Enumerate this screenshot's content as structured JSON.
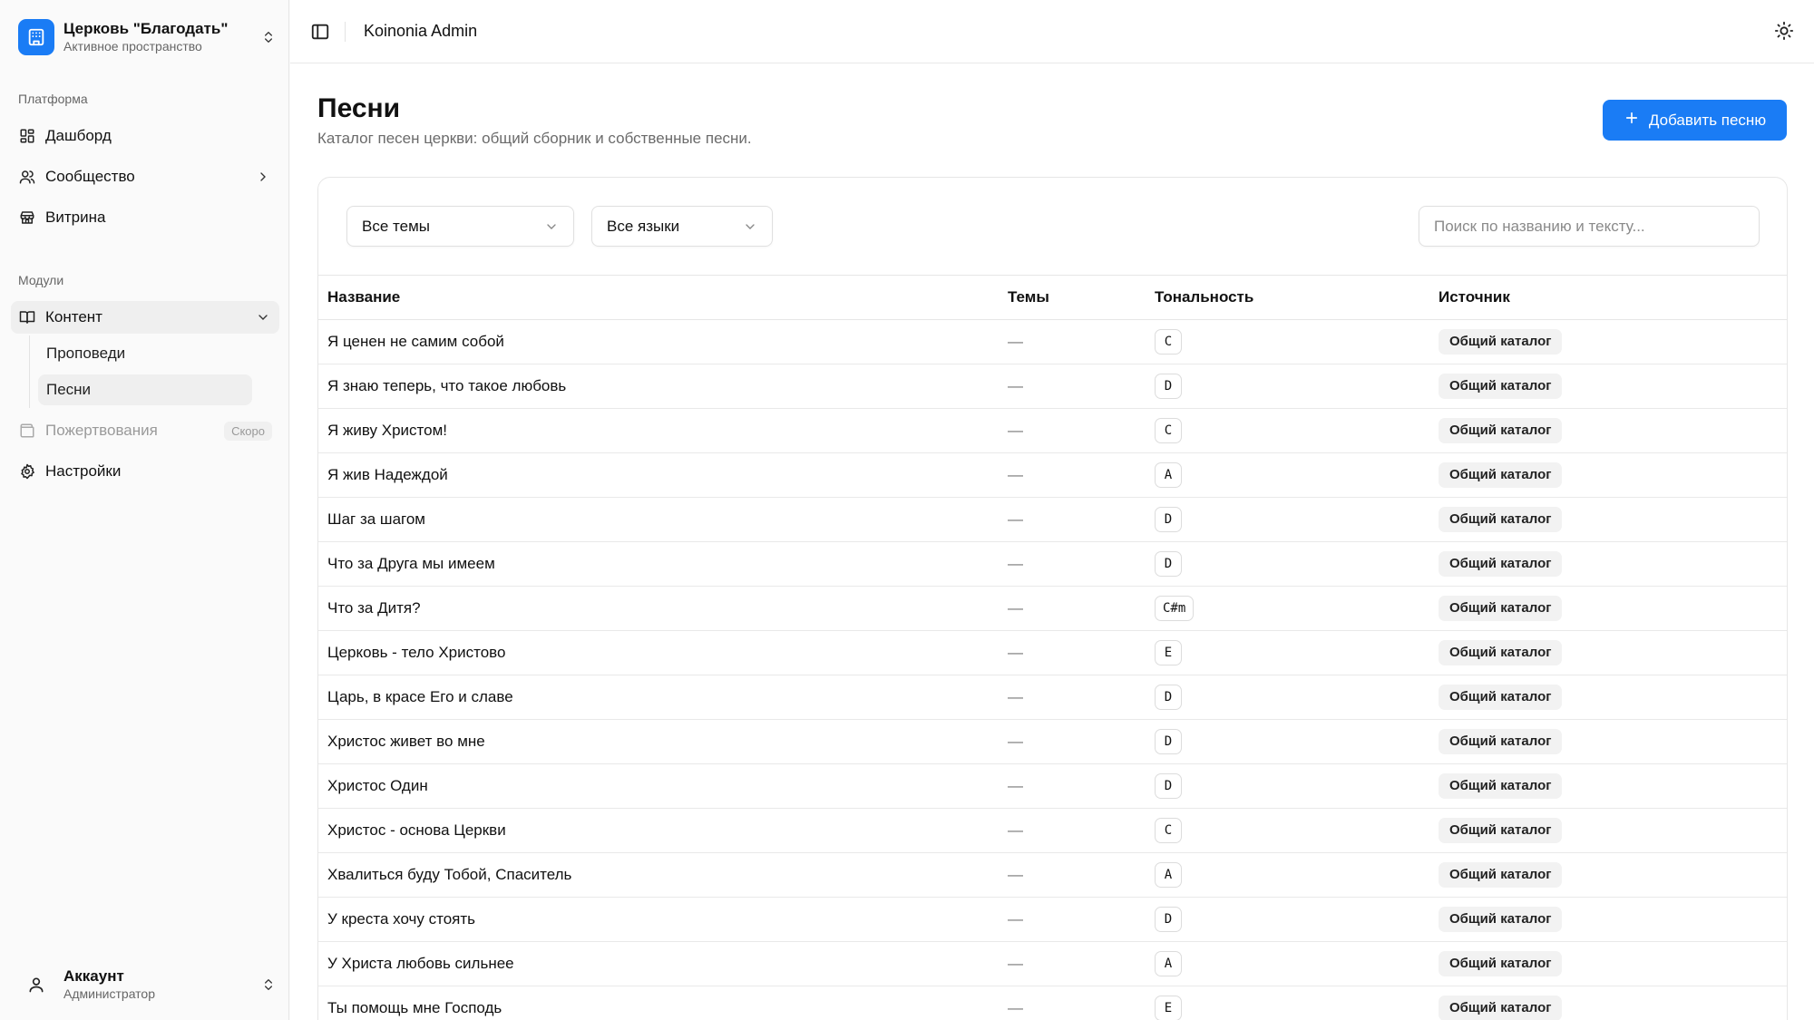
{
  "workspace": {
    "title": "Церковь \"Благодать\"",
    "subtitle": "Активное пространство"
  },
  "sidebar": {
    "platform_label": "Платформа",
    "modules_label": "Модули",
    "items": [
      {
        "label": "Дашборд"
      },
      {
        "label": "Сообщество"
      },
      {
        "label": "Витрина"
      },
      {
        "label": "Контент"
      },
      {
        "label": "Пожертвования",
        "badge": "Скоро"
      },
      {
        "label": "Настройки"
      }
    ],
    "content_sub": [
      {
        "label": "Проповеди"
      },
      {
        "label": "Песни"
      }
    ]
  },
  "account": {
    "title": "Аккаунт",
    "subtitle": "Администратор"
  },
  "topbar": {
    "title": "Koinonia Admin"
  },
  "page": {
    "title": "Песни",
    "subtitle": "Каталог песен церкви: общий сборник и собственные песни.",
    "add_button": "Добавить песню"
  },
  "filters": {
    "themes": "Все темы",
    "languages": "Все языки",
    "search_placeholder": "Поиск по названию и тексту..."
  },
  "table": {
    "headers": {
      "name": "Название",
      "themes": "Темы",
      "key": "Тональность",
      "source": "Источник"
    },
    "rows": [
      {
        "name": "Я ценен не самим собой",
        "themes": "—",
        "key": "C",
        "source": "Общий каталог"
      },
      {
        "name": "Я знаю теперь, что такое любовь",
        "themes": "—",
        "key": "D",
        "source": "Общий каталог"
      },
      {
        "name": "Я живу Христом!",
        "themes": "—",
        "key": "C",
        "source": "Общий каталог"
      },
      {
        "name": "Я жив Надеждой",
        "themes": "—",
        "key": "A",
        "source": "Общий каталог"
      },
      {
        "name": "Шаг за шагом",
        "themes": "—",
        "key": "D",
        "source": "Общий каталог"
      },
      {
        "name": "Что за Друга мы имеем",
        "themes": "—",
        "key": "D",
        "source": "Общий каталог"
      },
      {
        "name": "Что за Дитя?",
        "themes": "—",
        "key": "C#m",
        "source": "Общий каталог"
      },
      {
        "name": "Церковь - тело Христово",
        "themes": "—",
        "key": "E",
        "source": "Общий каталог"
      },
      {
        "name": "Царь, в красе Его и славе",
        "themes": "—",
        "key": "D",
        "source": "Общий каталог"
      },
      {
        "name": "Христос живет во мне",
        "themes": "—",
        "key": "D",
        "source": "Общий каталог"
      },
      {
        "name": "Христос Один",
        "themes": "—",
        "key": "D",
        "source": "Общий каталог"
      },
      {
        "name": "Христос - основа Церкви",
        "themes": "—",
        "key": "C",
        "source": "Общий каталог"
      },
      {
        "name": "Хвалиться буду Тобой, Спаситель",
        "themes": "—",
        "key": "A",
        "source": "Общий каталог"
      },
      {
        "name": "У креста хочу стоять",
        "themes": "—",
        "key": "D",
        "source": "Общий каталог"
      },
      {
        "name": "У Христа любовь сильнее",
        "themes": "—",
        "key": "A",
        "source": "Общий каталог"
      },
      {
        "name": "Ты помощь мне Господь",
        "themes": "—",
        "key": "E",
        "source": "Общий каталог"
      }
    ]
  }
}
